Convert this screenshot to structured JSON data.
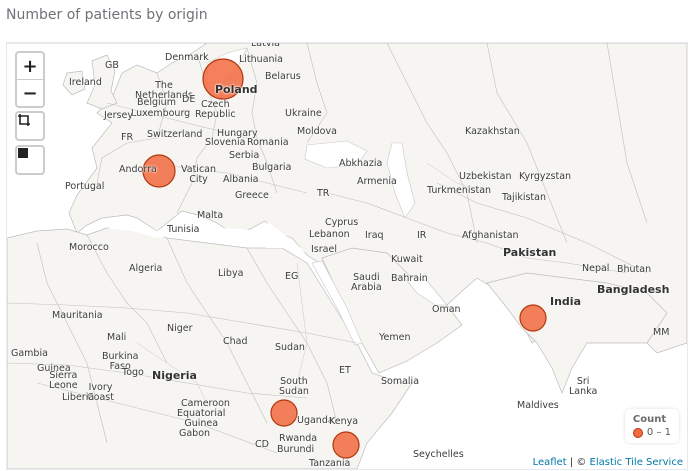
{
  "panel": {
    "title": "Number of patients by origin"
  },
  "controls": {
    "zoom_in": "+",
    "zoom_out": "−",
    "crop_icon": "crop-icon",
    "stop_icon": "stop-square-icon"
  },
  "legend": {
    "title": "Count",
    "range": "0 – 1",
    "color": "#f26a3f"
  },
  "attribution": {
    "leaflet": "Leaflet",
    "sep": " | © ",
    "tiles": "Elastic Tile Service"
  },
  "colors": {
    "land": "#f6f5f2",
    "water": "#ffffff",
    "border": "#b9b9b9",
    "marker_fill": "#f26a3f",
    "marker_stroke": "#b2360e"
  },
  "markers": [
    {
      "name": "Poland",
      "count": 1
    },
    {
      "name": "Andorra",
      "count": 1
    },
    {
      "name": "India",
      "count": 1
    },
    {
      "name": "Uganda",
      "count": 1
    },
    {
      "name": "Kenya",
      "count": 1
    }
  ],
  "labels": {
    "latvia": "Latvia",
    "denmark": "Denmark",
    "lithuania": "Lithuania",
    "gb": "GB",
    "ireland": "Ireland",
    "belarus": "Belarus",
    "netherlands": "The\nNetherlands",
    "belgium": "Belgium",
    "luxembourg": "Luxembourg",
    "de": "DE",
    "poland": "Poland",
    "czech": "Czech\nRepublic",
    "jersey": "Jersey",
    "ukraine": "Ukraine",
    "kazakhstan": "Kazakhstan",
    "fr": "FR",
    "switzerland": "Switzerland",
    "hungary": "Hungary",
    "moldova": "Moldova",
    "slovenia": "Slovenia",
    "romania": "Romania",
    "serbia": "Serbia",
    "andorra": "Andorra",
    "vatican": "Vatican\nCity",
    "bulgaria": "Bulgaria",
    "abkhazia": "Abkhazia",
    "uzbekistan": "Uzbekistan",
    "kyrgyzstan": "Kyrgyzstan",
    "portugal": "Portugal",
    "albania": "Albania",
    "armenia": "Armenia",
    "turkmenistan": "Turkmenistan",
    "greece": "Greece",
    "tajikistan": "Tajikistan",
    "tr": "TR",
    "malta": "Malta",
    "tunisia": "Tunisia",
    "cyprus": "Cyprus",
    "lebanon": "Lebanon",
    "iraq": "Iraq",
    "ir": "IR",
    "afghanistan": "Afghanistan",
    "morocco": "Morocco",
    "israel": "Israel",
    "kuwait": "Kuwait",
    "pakistan": "Pakistan",
    "algeria": "Algeria",
    "libya": "Libya",
    "eg": "EG",
    "saudi": "Saudi\nArabia",
    "bahrain": "Bahrain",
    "nepal": "Nepal",
    "bhutan": "Bhutan",
    "india": "India",
    "bangladesh": "Bangladesh",
    "mauritania": "Mauritania",
    "oman": "Oman",
    "mali": "Mali",
    "niger": "Niger",
    "mm": "MM",
    "chad": "Chad",
    "sudan": "Sudan",
    "yemen": "Yemen",
    "gambia": "Gambia",
    "burkina": "Burkina\nFaso",
    "guinea": "Guinea",
    "togo": "Togo",
    "nigeria": "Nigeria",
    "sierra": "Sierra\nLeone",
    "ivory": "Ivory\nCoast",
    "liberia": "Liberia",
    "south_sudan": "South\nSudan",
    "et": "ET",
    "somalia": "Somalia",
    "srilanka": "Sri\nLanka",
    "cameroon": "Cameroon",
    "maldives": "Maldives",
    "eqguinea": "Equatorial\nGuinea",
    "gabon": "Gabon",
    "uganda": "Uganda",
    "kenya": "Kenya",
    "cd": "CD",
    "rwanda": "Rwanda",
    "burundi": "Burundi",
    "seychelles": "Seychelles",
    "tanzania": "Tanzania"
  }
}
